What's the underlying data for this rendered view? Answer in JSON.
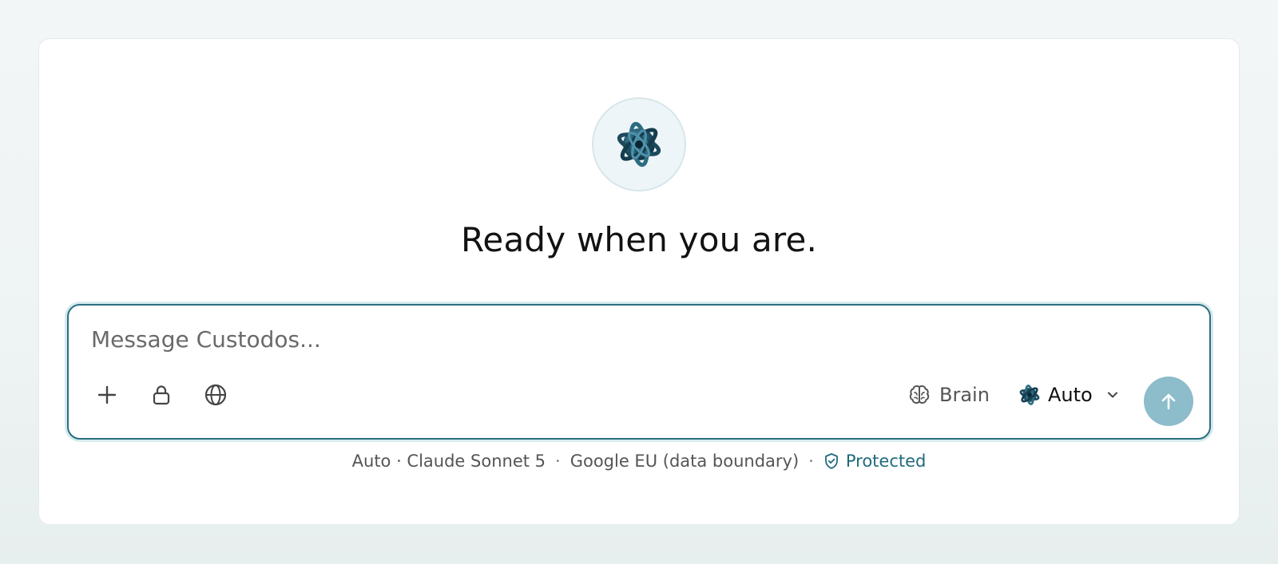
{
  "brand": {
    "logo_icon": "custodos-orb-icon",
    "accent_color": "#2b6f7f",
    "send_color": "#8dbccb"
  },
  "hero": {
    "heading": "Ready when you are."
  },
  "composer": {
    "placeholder": "Message Custodos...",
    "value": "",
    "tools": [
      {
        "icon": "plus-icon"
      },
      {
        "icon": "lock-icon"
      },
      {
        "icon": "globe-icon"
      }
    ],
    "brain_label": "Brain",
    "model_label": "Auto",
    "send_icon": "arrow-up-icon"
  },
  "footer": {
    "mode": "Auto · Claude Sonnet 5",
    "region": "Google EU (data boundary)",
    "separator": "·",
    "protected_label": "Protected"
  }
}
